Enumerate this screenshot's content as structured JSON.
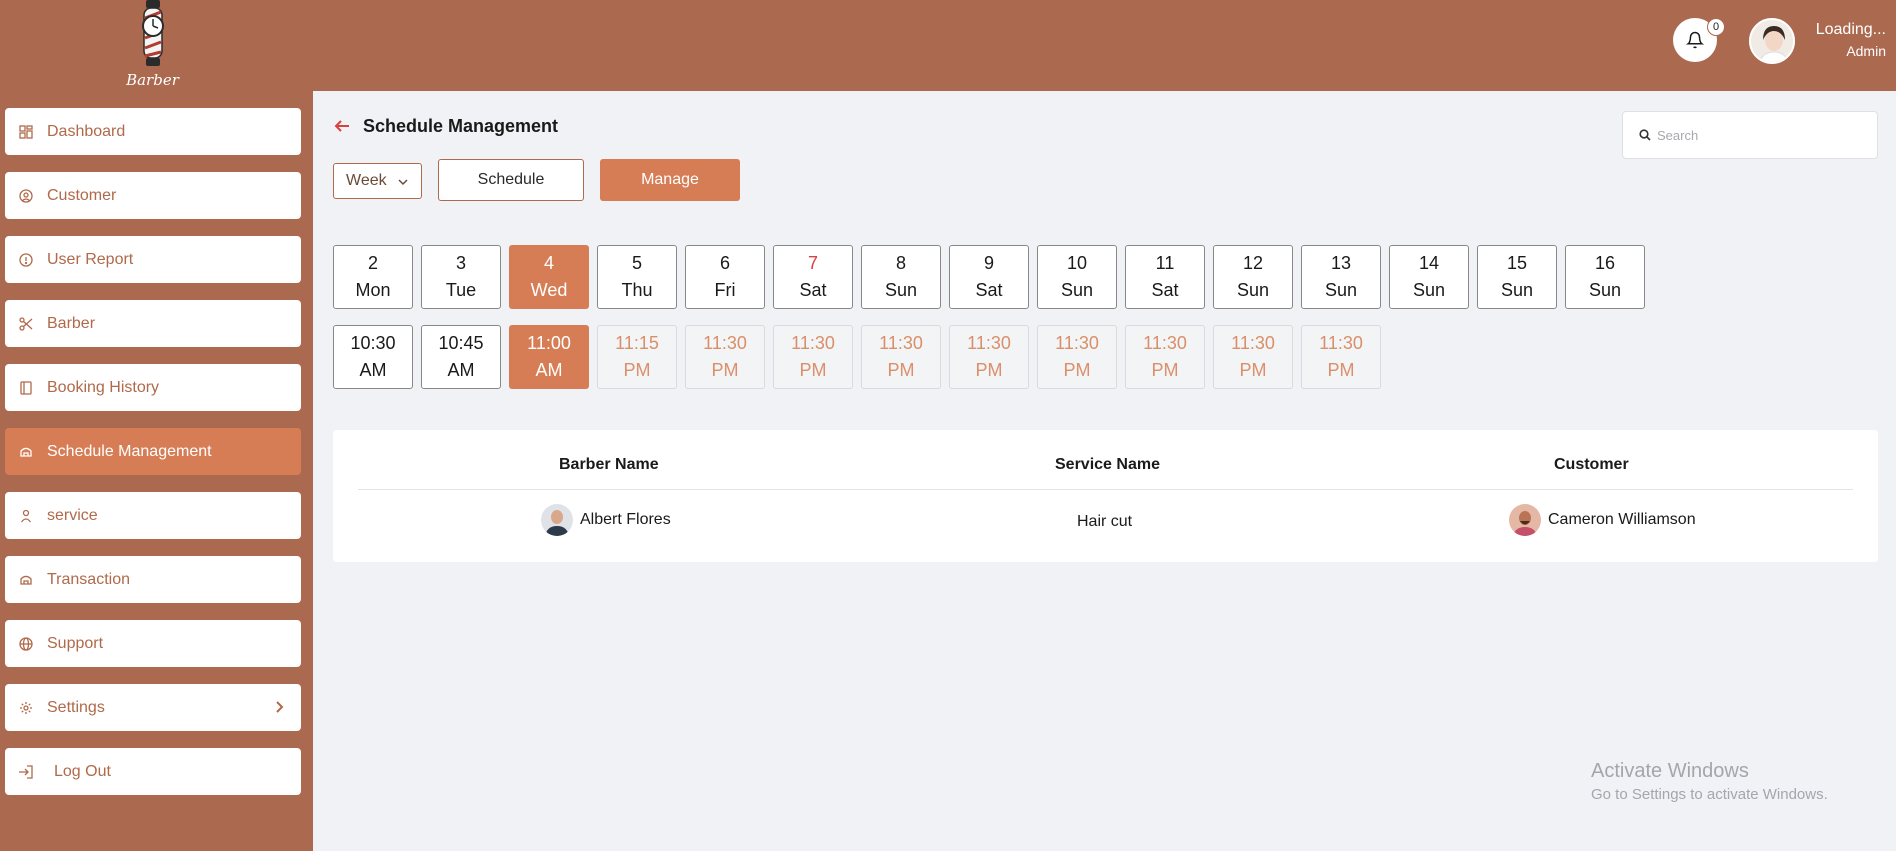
{
  "app": {
    "name": "Barber Time"
  },
  "header": {
    "notification_count": "0",
    "user_name": "Loading...",
    "user_role": "Admin"
  },
  "sidebar": {
    "items": [
      {
        "label": "Dashboard",
        "icon": "dashboard-grid-icon"
      },
      {
        "label": "Customer",
        "icon": "user-circle-icon"
      },
      {
        "label": "User Report",
        "icon": "info-circle-icon"
      },
      {
        "label": "Barber",
        "icon": "scissors-icon"
      },
      {
        "label": "Booking History",
        "icon": "book-icon"
      },
      {
        "label": "Schedule Management",
        "icon": "schedule-icon",
        "active": true
      },
      {
        "label": "service",
        "icon": "person-icon"
      },
      {
        "label": "Transaction",
        "icon": "transaction-icon"
      },
      {
        "label": "Support",
        "icon": "globe-icon"
      },
      {
        "label": "Settings",
        "icon": "gear-icon",
        "has_submenu": true
      },
      {
        "label": "Log Out",
        "icon": "logout-icon"
      }
    ]
  },
  "page": {
    "title": "Schedule Management"
  },
  "search": {
    "placeholder": "Search"
  },
  "controls": {
    "range_select": "Week",
    "schedule_label": "Schedule",
    "manage_label": "Manage"
  },
  "days": [
    {
      "num": "2",
      "day": "Mon"
    },
    {
      "num": "3",
      "day": "Tue"
    },
    {
      "num": "4",
      "day": "Wed",
      "selected": true
    },
    {
      "num": "5",
      "day": "Thu"
    },
    {
      "num": "6",
      "day": "Fri"
    },
    {
      "num": "7",
      "day": "Sat",
      "highlight": true
    },
    {
      "num": "8",
      "day": "Sun"
    },
    {
      "num": "9",
      "day": "Sat"
    },
    {
      "num": "10",
      "day": "Sun"
    },
    {
      "num": "11",
      "day": "Sat"
    },
    {
      "num": "12",
      "day": "Sun"
    },
    {
      "num": "13",
      "day": "Sun"
    },
    {
      "num": "14",
      "day": "Sun"
    },
    {
      "num": "15",
      "day": "Sun"
    },
    {
      "num": "16",
      "day": "Sun"
    }
  ],
  "times": [
    {
      "time": "10:30",
      "period": "AM",
      "state": "available"
    },
    {
      "time": "10:45",
      "period": "AM",
      "state": "available"
    },
    {
      "time": "11:00",
      "period": "AM",
      "state": "selected"
    },
    {
      "time": "11:15",
      "period": "PM",
      "state": "disabled"
    },
    {
      "time": "11:30",
      "period": "PM",
      "state": "disabled"
    },
    {
      "time": "11:30",
      "period": "PM",
      "state": "disabled"
    },
    {
      "time": "11:30",
      "period": "PM",
      "state": "disabled"
    },
    {
      "time": "11:30",
      "period": "PM",
      "state": "disabled"
    },
    {
      "time": "11:30",
      "period": "PM",
      "state": "disabled"
    },
    {
      "time": "11:30",
      "period": "PM",
      "state": "disabled"
    },
    {
      "time": "11:30",
      "period": "PM",
      "state": "disabled"
    },
    {
      "time": "11:30",
      "period": "PM",
      "state": "disabled"
    }
  ],
  "table": {
    "headers": {
      "barber": "Barber Name",
      "service": "Service Name",
      "customer": "Customer"
    },
    "rows": [
      {
        "barber": "Albert Flores",
        "service": "Hair cut",
        "customer": "Cameron Williamson"
      }
    ]
  },
  "watermark": {
    "line1": "Activate Windows",
    "line2": "Go to Settings to activate Windows."
  },
  "colors": {
    "brand": "#ab6a4f",
    "accent": "#d67d55",
    "background": "#f0f2f6",
    "highlight_day": "#d94040"
  }
}
